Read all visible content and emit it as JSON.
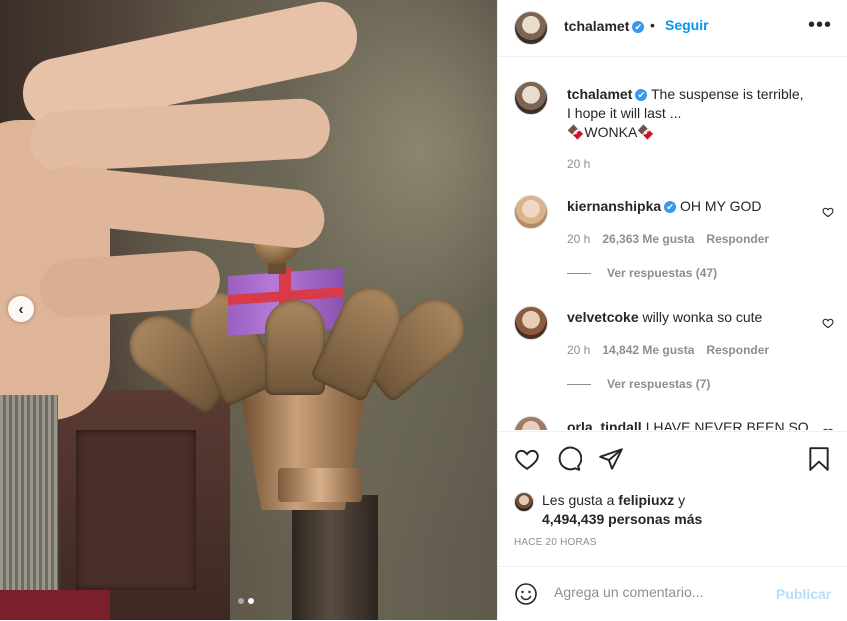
{
  "post": {
    "username": "tchalamet",
    "verified_mark": "✔",
    "dot": "•",
    "follow_label": "Seguir",
    "more_icon": "•••",
    "caption_line1": "The suspense is terrible,",
    "caption_line2": "I hope it will last ...",
    "caption_line3": "🍫WONKA🍫",
    "caption_time": "20 h"
  },
  "carousel": {
    "prev_icon": "‹",
    "total": 2,
    "current": 2
  },
  "comments": [
    {
      "username": "kiernanshipka",
      "verified": true,
      "text": "OH MY GOD",
      "time": "20 h",
      "likes": "26,363 Me gusta",
      "reply_label": "Responder",
      "view_replies": "Ver respuestas (47)"
    },
    {
      "username": "velvetcoke",
      "verified": false,
      "text": "willy wonka so cute",
      "time": "20 h",
      "likes": "14,842 Me gusta",
      "reply_label": "Responder",
      "view_replies": "Ver respuestas (7)"
    },
    {
      "username": "orla_tindall",
      "verified": false,
      "text": "I HAVE NEVER BEEN SO"
    }
  ],
  "likes": {
    "prefix": "Les gusta a ",
    "user": "felipiuxz",
    "suffix": " y",
    "others": "4,494,439 personas más"
  },
  "timestamp": "HACE 20 HORAS",
  "comment_form": {
    "placeholder": "Agrega un comentario...",
    "publish_label": "Publicar"
  },
  "icons": {
    "like": "heart-icon",
    "comment": "comment-icon",
    "share": "send-icon",
    "save": "bookmark-icon",
    "emoji": "emoji-icon"
  },
  "colors": {
    "link_blue": "#0095f6",
    "verified_blue": "#3897f0",
    "muted": "#8e8e8e",
    "publish_disabled": "#b2dffc"
  }
}
